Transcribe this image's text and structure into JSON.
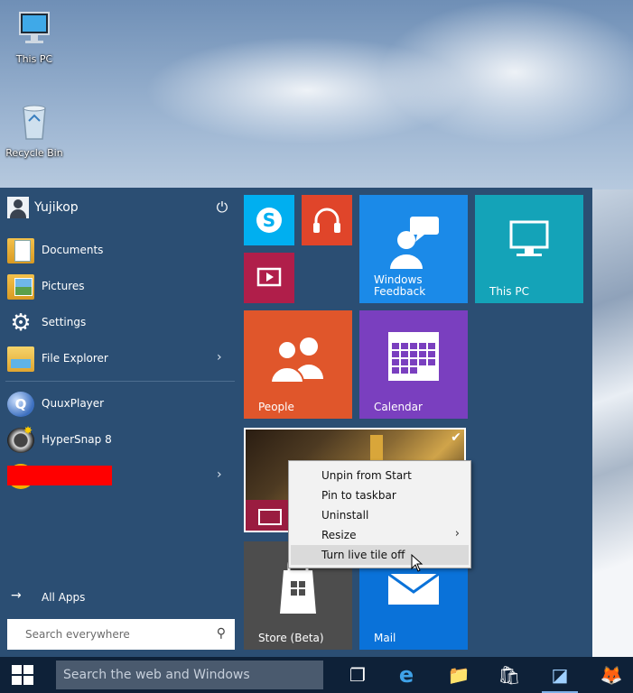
{
  "desktop": {
    "icons": [
      {
        "label": "This PC",
        "icon": "computer-icon"
      },
      {
        "label": "Recycle Bin",
        "icon": "recycle-bin-icon"
      }
    ]
  },
  "start_menu": {
    "user": {
      "name": "Yujikop",
      "power_icon": "⏻"
    },
    "places": [
      {
        "label": "Documents",
        "icon": "documents-icon"
      },
      {
        "label": "Pictures",
        "icon": "pictures-icon"
      },
      {
        "label": "Settings",
        "icon": "settings-icon"
      },
      {
        "label": "File Explorer",
        "icon": "file-explorer-icon",
        "chevron": "›"
      }
    ],
    "recent_apps": [
      {
        "label": "QuuxPlayer",
        "icon": "quuxplayer-icon",
        "icon_text": "Q"
      },
      {
        "label": "HyperSnap 8",
        "icon": "hypersnap-icon"
      },
      {
        "label": "",
        "icon": "redacted-app-icon",
        "chevron": "›",
        "redacted": true
      }
    ],
    "all_apps": {
      "label": "All Apps",
      "arrow": "→"
    },
    "search": {
      "placeholder": "Search everywhere",
      "icon": "⚲"
    }
  },
  "tiles": {
    "skype": {
      "label": "",
      "glyph": "S"
    },
    "music": {
      "label": "",
      "glyph": "🎧"
    },
    "video": {
      "label": "",
      "glyph": "▶"
    },
    "feedback": {
      "label": "Windows\nFeedback"
    },
    "thispc": {
      "label": "This PC"
    },
    "people": {
      "label": "People"
    },
    "calendar": {
      "label": "Calendar"
    },
    "news": {
      "label": "",
      "checkmark": "✔"
    },
    "store": {
      "label": "Store (Beta)"
    },
    "mail": {
      "label": "Mail"
    }
  },
  "context_menu": {
    "items": [
      {
        "label": "Unpin from Start"
      },
      {
        "label": "Pin to taskbar"
      },
      {
        "label": "Uninstall"
      },
      {
        "label": "Resize",
        "chevron": "›"
      },
      {
        "label": "Turn live tile off",
        "hover": true
      }
    ]
  },
  "taskbar": {
    "search_placeholder": "Search the web and Windows",
    "buttons": [
      {
        "name": "task-view",
        "glyph": "❐"
      },
      {
        "name": "internet-explorer",
        "glyph": "e"
      },
      {
        "name": "file-explorer",
        "glyph": "📁"
      },
      {
        "name": "store",
        "glyph": "🛍"
      },
      {
        "name": "app-blue",
        "glyph": "◪",
        "active": true
      },
      {
        "name": "firefox",
        "glyph": "🦊"
      }
    ]
  },
  "colors": {
    "start_bg": "#2b4e73",
    "taskbar_bg": "#0e2138",
    "skype": "#00aff0",
    "music": "#e0452a",
    "video": "#b01e4a",
    "feedback": "#1b8ae8",
    "thispc": "#14a3b8",
    "people": "#e0562b",
    "calendar": "#7a3fbf",
    "store": "#4d4d4d",
    "mail": "#0a72d9"
  }
}
